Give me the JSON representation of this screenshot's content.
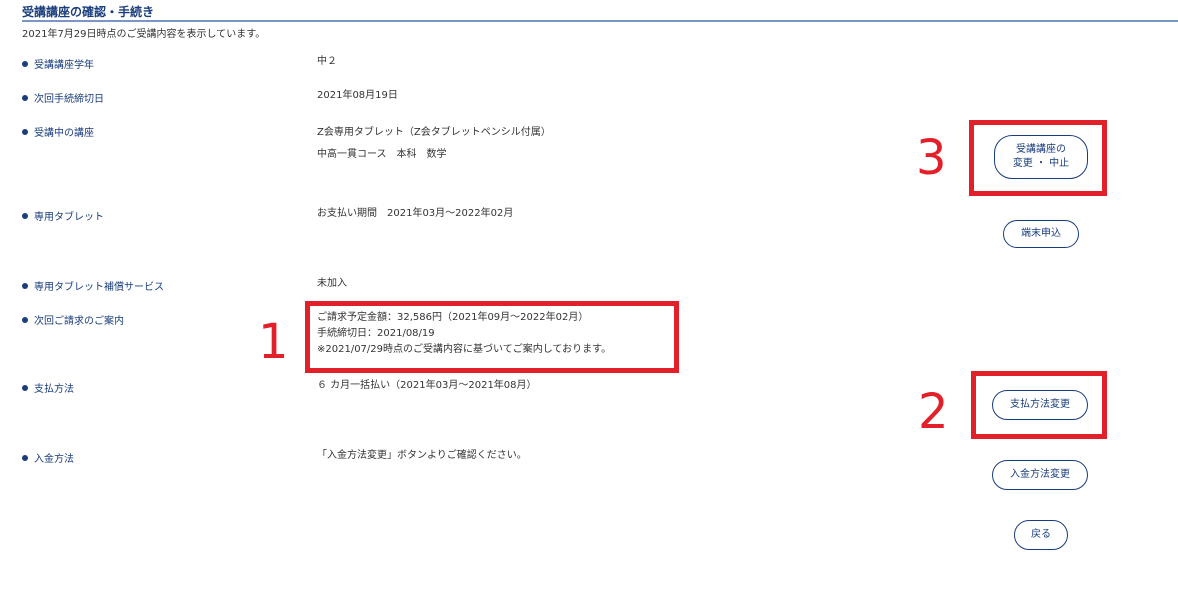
{
  "header": {
    "title": "受講講座の確認・手続き",
    "subtitle": "2021年7月29日時点のご受講内容を表示しています。"
  },
  "rows": [
    {
      "label": "受講講座学年",
      "lines": [
        "中２"
      ]
    },
    {
      "label": "次回手続締切日",
      "lines": [
        "2021年08月19日"
      ]
    },
    {
      "label": "受講中の講座",
      "lines": [
        "Z会専用タブレット（Z会タブレットペンシル付属）",
        "中高一貫コース　本科　数学"
      ]
    },
    {
      "label": "専用タブレット",
      "lines": [
        "お支払い期間　2021年03月～2022年02月"
      ]
    },
    {
      "label": "専用タブレット補償サービス",
      "lines": [
        "未加入"
      ]
    },
    {
      "label": "次回ご請求のご案内",
      "lines": [
        "ご請求予定金額：32,586円（2021年09月～2022年02月）",
        "手続締切日：2021/08/19",
        "※2021/07/29時点のご受講内容に基づいてご案内しております。"
      ]
    },
    {
      "label": "支払方法",
      "lines": [
        "６ カ月一括払い（2021年03月～2021年08月）"
      ]
    },
    {
      "label": "入金方法",
      "lines": [
        "「入金方法変更」ボタンよりご確認ください。"
      ]
    }
  ],
  "buttons": {
    "change_course_line1": "受講講座の",
    "change_course_line2": "変更 ・ 中止",
    "device_apply": "端末申込",
    "payment_method_change": "支払方法変更",
    "deposit_method_change": "入金方法変更",
    "back": "戻る"
  },
  "annotations": {
    "marker_1": "1",
    "marker_2": "2",
    "marker_3": "3",
    "color": "#e2202a"
  },
  "colors": {
    "accent": "#1a3d7c",
    "rule": "#7a96c4",
    "text": "#333333"
  }
}
